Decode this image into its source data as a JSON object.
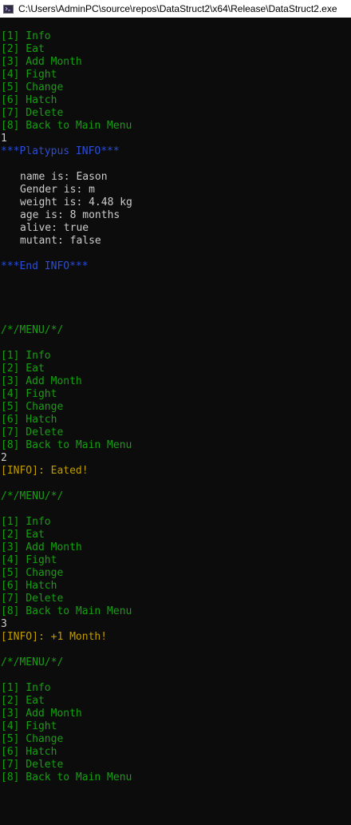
{
  "window": {
    "title": "C:\\Users\\AdminPC\\source\\repos\\DataStruct2\\x64\\Release\\DataStruct2.exe"
  },
  "menu": {
    "header": "/*/MENU/*/",
    "items": [
      "[1] Info",
      "[2] Eat",
      "[3] Add Month",
      "[4] Fight",
      "[5] Change",
      "[6] Hatch",
      "[7] Delete",
      "[8] Back to Main Menu"
    ]
  },
  "inputs": {
    "first": "1",
    "second": "2",
    "third": "3"
  },
  "info": {
    "header": "***Platypus INFO***",
    "lines": [
      "name is: Eason",
      "Gender is: m",
      "weight is: 4.48 kg",
      "age is: 8 months",
      "alive: true",
      "mutant: false"
    ],
    "footer": "***End INFO***"
  },
  "messages": {
    "eat": "[INFO]: Eated!",
    "month": "[INFO]: +1 Month!"
  },
  "colors": {
    "menu": "#13a10e",
    "input": "#cccccc",
    "info_header": "#2a4ddb",
    "info_message": "#c19c00",
    "background": "#0c0c0c"
  }
}
